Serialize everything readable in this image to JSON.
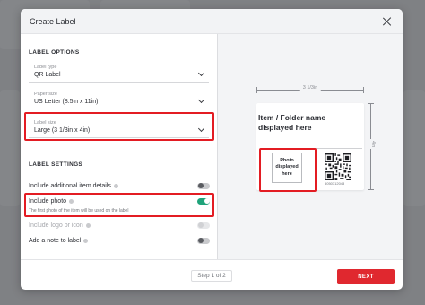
{
  "modal": {
    "title": "Create Label",
    "close_icon": "close-icon"
  },
  "label_options": {
    "section_title": "LABEL OPTIONS",
    "label_type": {
      "label": "Label type",
      "value": "QR Label"
    },
    "paper_size": {
      "label": "Paper size",
      "value": "US Letter (8.5in x 11in)"
    },
    "label_size": {
      "label": "Label size",
      "value": "Large (3 1/3in x 4in)"
    }
  },
  "label_settings": {
    "section_title": "LABEL SETTINGS",
    "items": [
      {
        "label": "Include additional item details",
        "toggle": "off",
        "info": true
      },
      {
        "label": "Include photo",
        "toggle": "on",
        "info": true,
        "helper": "The first photo of the item will be used on the label"
      },
      {
        "label": "Include logo or icon",
        "toggle": "disabled",
        "info": true
      },
      {
        "label": "Add a note to label",
        "toggle": "off",
        "info": true
      }
    ]
  },
  "preview": {
    "width_dim": "3 1/3in",
    "height_dim": "4in",
    "title": "Item / Folder name displayed here",
    "photo_text": "Photo displayed here",
    "qr_code_text": "5050312043"
  },
  "footer": {
    "step_text": "Step 1 of 2",
    "next_label": "NEXT"
  },
  "colors": {
    "accent": "#e0282f",
    "highlight": "#e31c23",
    "toggle_on": "#1fa37a"
  }
}
